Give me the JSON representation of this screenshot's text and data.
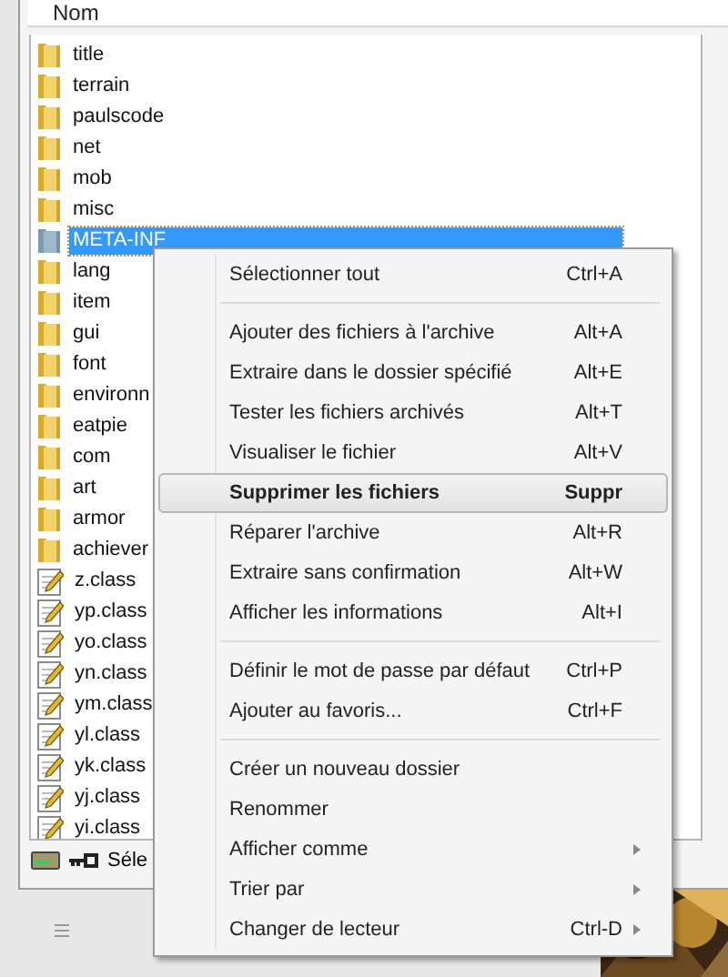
{
  "list": {
    "column": "Nom",
    "rows": [
      {
        "name": "title",
        "kind": "folder",
        "selected": false
      },
      {
        "name": "terrain",
        "kind": "folder",
        "selected": false
      },
      {
        "name": "paulscode",
        "kind": "folder",
        "selected": false
      },
      {
        "name": "net",
        "kind": "folder",
        "selected": false
      },
      {
        "name": "mob",
        "kind": "folder",
        "selected": false
      },
      {
        "name": "misc",
        "kind": "folder",
        "selected": false
      },
      {
        "name": "META-INF",
        "kind": "folder",
        "selected": true
      },
      {
        "name": "lang",
        "kind": "folder",
        "selected": false
      },
      {
        "name": "item",
        "kind": "folder",
        "selected": false
      },
      {
        "name": "gui",
        "kind": "folder",
        "selected": false
      },
      {
        "name": "font",
        "kind": "folder",
        "selected": false
      },
      {
        "name": "environn",
        "kind": "folder",
        "selected": false
      },
      {
        "name": "eatpie",
        "kind": "folder",
        "selected": false
      },
      {
        "name": "com",
        "kind": "folder",
        "selected": false
      },
      {
        "name": "art",
        "kind": "folder",
        "selected": false
      },
      {
        "name": "armor",
        "kind": "folder",
        "selected": false
      },
      {
        "name": "achiever",
        "kind": "folder",
        "selected": false
      },
      {
        "name": "z.class",
        "kind": "file",
        "selected": false
      },
      {
        "name": "yp.class",
        "kind": "file",
        "selected": false
      },
      {
        "name": "yo.class",
        "kind": "file",
        "selected": false
      },
      {
        "name": "yn.class",
        "kind": "file",
        "selected": false
      },
      {
        "name": "ym.class",
        "kind": "file",
        "selected": false
      },
      {
        "name": "yl.class",
        "kind": "file",
        "selected": false
      },
      {
        "name": "yk.class",
        "kind": "file",
        "selected": false
      },
      {
        "name": "yj.class",
        "kind": "file",
        "selected": false
      },
      {
        "name": "yi.class",
        "kind": "file",
        "selected": false
      }
    ]
  },
  "status_bar": {
    "text": "Séle"
  },
  "context_menu": {
    "items": [
      {
        "kind": "item",
        "label": "Sélectionner tout",
        "shortcut": "Ctrl+A",
        "selected": false,
        "submenu": false
      },
      {
        "kind": "separator"
      },
      {
        "kind": "item",
        "label": "Ajouter des fichiers à l'archive",
        "shortcut": "Alt+A",
        "selected": false,
        "submenu": false
      },
      {
        "kind": "item",
        "label": "Extraire dans le dossier spécifié",
        "shortcut": "Alt+E",
        "selected": false,
        "submenu": false
      },
      {
        "kind": "item",
        "label": "Tester les fichiers archivés",
        "shortcut": "Alt+T",
        "selected": false,
        "submenu": false
      },
      {
        "kind": "item",
        "label": "Visualiser le fichier",
        "shortcut": "Alt+V",
        "selected": false,
        "submenu": false
      },
      {
        "kind": "item",
        "label": "Supprimer les fichiers",
        "shortcut": "Suppr",
        "selected": true,
        "submenu": false
      },
      {
        "kind": "item",
        "label": "Réparer l'archive",
        "shortcut": "Alt+R",
        "selected": false,
        "submenu": false
      },
      {
        "kind": "item",
        "label": "Extraire sans confirmation",
        "shortcut": "Alt+W",
        "selected": false,
        "submenu": false
      },
      {
        "kind": "item",
        "label": "Afficher les informations",
        "shortcut": "Alt+I",
        "selected": false,
        "submenu": false
      },
      {
        "kind": "separator"
      },
      {
        "kind": "item",
        "label": "Définir le mot de passe par défaut",
        "shortcut": "Ctrl+P",
        "selected": false,
        "submenu": false
      },
      {
        "kind": "item",
        "label": "Ajouter au favoris...",
        "shortcut": "Ctrl+F",
        "selected": false,
        "submenu": false
      },
      {
        "kind": "separator"
      },
      {
        "kind": "item",
        "label": "Créer un nouveau dossier",
        "selected": false,
        "submenu": false
      },
      {
        "kind": "item",
        "label": "Renommer",
        "selected": false,
        "submenu": false
      },
      {
        "kind": "item",
        "label": "Afficher comme",
        "selected": false,
        "submenu": true
      },
      {
        "kind": "item",
        "label": "Trier par",
        "selected": false,
        "submenu": true
      },
      {
        "kind": "item",
        "label": "Changer de lecteur",
        "shortcut": "Ctrl-D",
        "selected": false,
        "submenu": true
      }
    ]
  }
}
